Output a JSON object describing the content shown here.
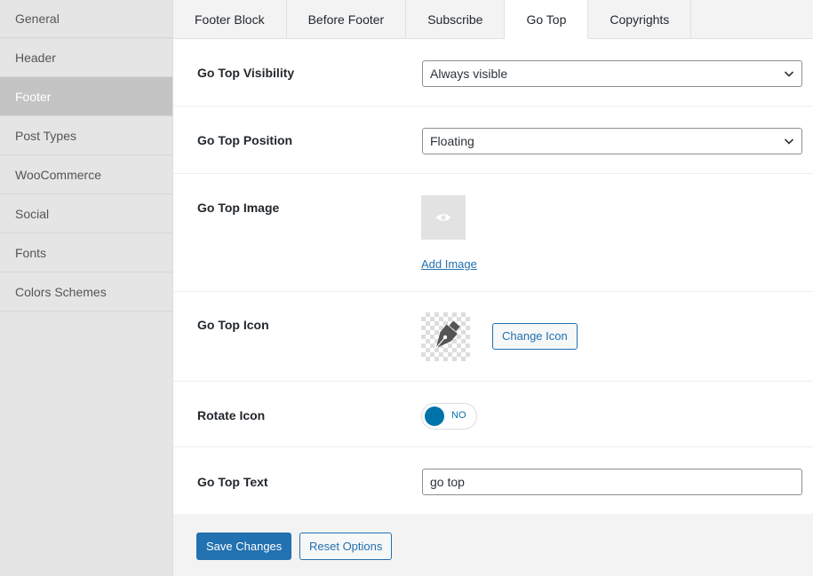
{
  "sidebar": {
    "items": [
      {
        "label": "General"
      },
      {
        "label": "Header"
      },
      {
        "label": "Footer"
      },
      {
        "label": "Post Types"
      },
      {
        "label": "WooCommerce"
      },
      {
        "label": "Social"
      },
      {
        "label": "Fonts"
      },
      {
        "label": "Colors Schemes"
      }
    ],
    "active": "Footer"
  },
  "tabs": {
    "items": [
      {
        "label": "Footer Block"
      },
      {
        "label": "Before Footer"
      },
      {
        "label": "Subscribe"
      },
      {
        "label": "Go Top"
      },
      {
        "label": "Copyrights"
      }
    ],
    "active": "Go Top"
  },
  "fields": {
    "visibility": {
      "label": "Go Top Visibility",
      "value": "Always visible"
    },
    "position": {
      "label": "Go Top Position",
      "value": "Floating"
    },
    "image": {
      "label": "Go Top Image",
      "add_label": "Add Image"
    },
    "icon": {
      "label": "Go Top Icon",
      "change_label": "Change Icon",
      "icon_name": "pen-nib-icon"
    },
    "rotate": {
      "label": "Rotate Icon",
      "state": "NO"
    },
    "text": {
      "label": "Go Top Text",
      "value": "go top"
    }
  },
  "actions": {
    "save_label": "Save Changes",
    "reset_label": "Reset Options"
  },
  "colors": {
    "accent": "#2271b1",
    "toggle": "#0073aa",
    "sidebar_active": "#c4c4c4"
  }
}
